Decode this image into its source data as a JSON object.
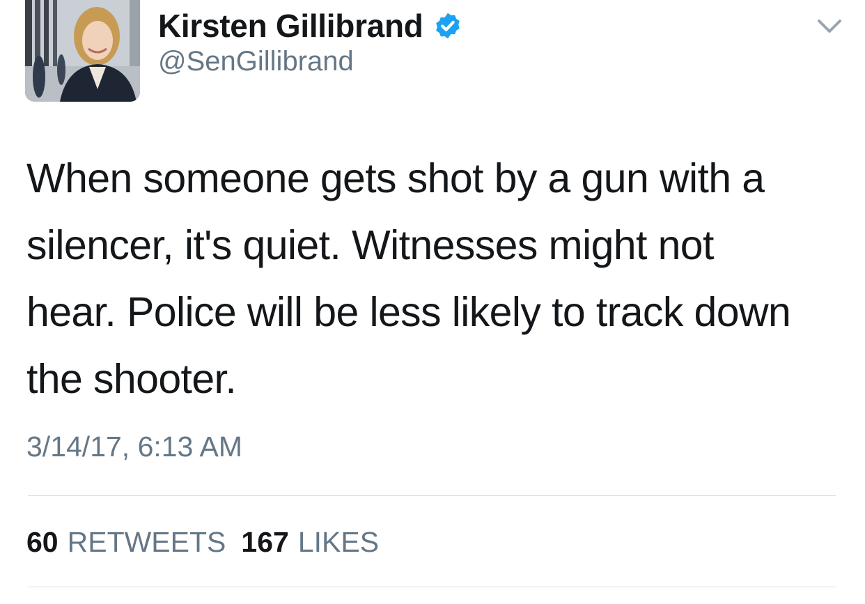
{
  "author": {
    "display_name": "Kirsten Gillibrand",
    "handle": "@SenGillibrand",
    "verified": true,
    "avatar_icon": "profile-photo"
  },
  "tweet": {
    "text": "When someone gets shot by a gun with a\nsilencer, it's quiet. Witnesses might not\nhear. Police will be less likely to track down\nthe shooter.",
    "timestamp": "3/14/17, 6:13 AM"
  },
  "stats": {
    "retweets_count": "60",
    "retweets_label": "RETWEETS",
    "likes_count": "167",
    "likes_label": "LIKES"
  },
  "colors": {
    "text_primary": "#14171a",
    "text_secondary": "#657786",
    "verified_blue": "#1da1f2",
    "divider": "#dcdfe2"
  }
}
